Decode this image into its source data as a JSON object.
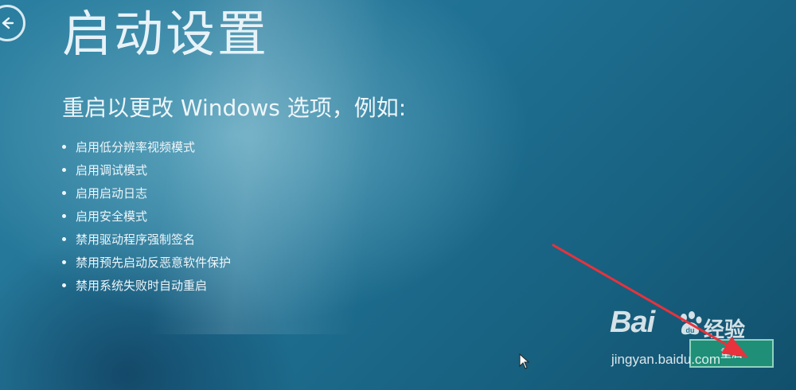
{
  "header": {
    "title": "启动设置",
    "back_icon": "back-arrow-icon"
  },
  "main": {
    "subtitle": "重启以更改 Windows 选项，例如:",
    "options": [
      "启用低分辨率视频模式",
      "启用调试模式",
      "启用启动日志",
      "启用安全模式",
      "禁用驱动程序强制签名",
      "禁用预先启动反恶意软件保护",
      "禁用系统失败时自动重启"
    ]
  },
  "footer": {
    "restart_label": "重启"
  },
  "watermark": {
    "brand": "Bai",
    "brand_cn": "经验",
    "url": "jingyan.baidu.com"
  },
  "colors": {
    "background": "#1f7093",
    "text": "#eef6fa",
    "button": "#1f8f78",
    "annotation_arrow": "#e8323c"
  }
}
